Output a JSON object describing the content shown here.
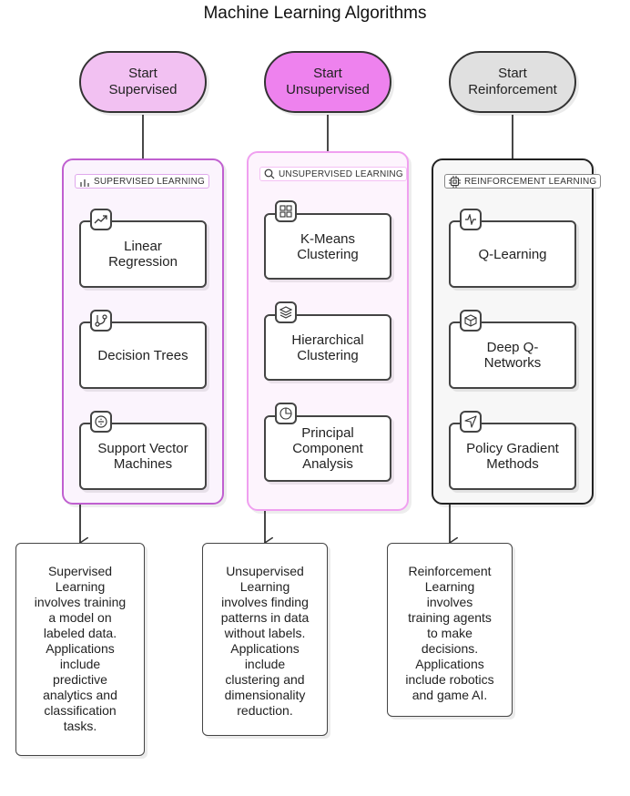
{
  "title": "Machine Learning Algorithms",
  "colors": {
    "supervised_fill": "#f2c1f2",
    "unsupervised_fill": "#ee82ee",
    "reinforcement_fill": "#e0e0e0",
    "supervised_border": "#c060d0",
    "unsupervised_border": "#f0a0f0",
    "reinforcement_border": "#222222",
    "group_bg_supervised": "#fbf4fd",
    "group_bg_unsupervised": "#fdf4fd",
    "group_bg_reinforcement": "#f7f7f7"
  },
  "starts": [
    {
      "line1": "Start",
      "line2": "Supervised"
    },
    {
      "line1": "Start",
      "line2": "Unsupervised"
    },
    {
      "line1": "Start",
      "line2": "Reinforcement"
    }
  ],
  "groups": [
    {
      "label": "SUPERVISED LEARNING",
      "icon": "bar-chart-icon",
      "nodes": [
        {
          "label": "Linear Regression",
          "icon": "trending-up-icon"
        },
        {
          "label": "Decision Trees",
          "icon": "git-branch-icon"
        },
        {
          "label": "Support Vector Machines",
          "icon": "divide-circle-icon"
        }
      ]
    },
    {
      "label": "UNSUPERVISED LEARNING",
      "icon": "search-icon",
      "nodes": [
        {
          "label": "K-Means Clustering",
          "icon": "grid-icon"
        },
        {
          "label": "Hierarchical Clustering",
          "icon": "layers-icon"
        },
        {
          "label": "Principal Component Analysis",
          "icon": "pie-chart-icon"
        }
      ]
    },
    {
      "label": "REINFORCEMENT LEARNING",
      "icon": "cpu-icon",
      "nodes": [
        {
          "label": "Q-Learning",
          "icon": "activity-icon"
        },
        {
          "label": "Deep Q-Networks",
          "icon": "box-icon"
        },
        {
          "label": "Policy Gradient Methods",
          "icon": "navigation-icon"
        }
      ]
    }
  ],
  "notes": [
    {
      "lines": [
        "Supervised",
        "Learning",
        "involves training",
        "a model on",
        "labeled data.",
        "Applications",
        "include",
        "predictive",
        "analytics and",
        "classification",
        "tasks."
      ]
    },
    {
      "lines": [
        "Unsupervised",
        "Learning",
        "involves finding",
        "patterns in data",
        "without labels.",
        "Applications",
        "include",
        "clustering and",
        "dimensionality",
        "reduction."
      ]
    },
    {
      "lines": [
        "Reinforcement",
        "Learning",
        "involves",
        "training agents",
        "to make",
        "decisions.",
        "Applications",
        "include robotics",
        "and game AI."
      ]
    }
  ]
}
